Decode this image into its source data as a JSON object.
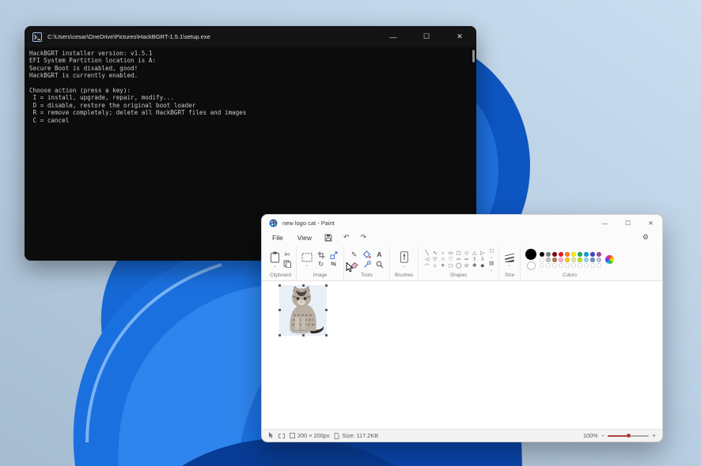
{
  "console": {
    "title": "C:\\Users\\cesar\\OneDrive\\Pictures\\HackBGRT-1.5.1\\setup.exe",
    "minimize": "—",
    "maximize": "☐",
    "close": "✕",
    "lines": [
      "HackBGRT installer version: v1.5.1",
      "EFI System Partition location is A:",
      "Secure Boot is disabled, good!",
      "HackBGRT is currently enabled.",
      "",
      "Choose action (press a key):",
      " I = install, upgrade, repair, modify...",
      " D = disable, restore the original boot loader",
      " R = remove completely; delete all HackBGRT files and images",
      " C = cancel"
    ]
  },
  "paint": {
    "title": "new logo cat - Paint",
    "minimize": "—",
    "maximize": "☐",
    "close": "✕",
    "menus": {
      "file": "File",
      "view": "View"
    },
    "undo": "↶",
    "redo": "↷",
    "settings": "⚙",
    "text_tool": "A",
    "sections": {
      "clipboard": "Clipboard",
      "image": "Image",
      "tools": "Tools",
      "brushes": "Brushes",
      "shapes": "Shapes",
      "size": "Size",
      "colors": "Colors"
    },
    "tool_chars": {
      "cut": "✄",
      "pencil": "✎",
      "rotate": "↻",
      "flip": "⇋"
    },
    "shapes_glyphs": [
      "╲",
      "∿",
      "○",
      "▭",
      "▢",
      "◇",
      "△",
      "▷",
      "◁",
      "▽",
      "☆",
      "♡",
      "⇦",
      "⇨",
      "⇧",
      "⇩",
      "◠",
      "⌂",
      "✶",
      "◻",
      "◯",
      "⊙",
      "✚",
      "◆"
    ],
    "colors": {
      "color1": "#000000",
      "color2": "#ffffff",
      "palette": [
        "#000000",
        "#7f7f7f",
        "#880015",
        "#ed1c24",
        "#ff7f27",
        "#fff200",
        "#22b14c",
        "#00a2e8",
        "#3f48cc",
        "#a349a4",
        "#ffffff",
        "#c3c3c3",
        "#b97a57",
        "#ffaec9",
        "#ffc90e",
        "#efe4b0",
        "#b5e61d",
        "#99d9ea",
        "#7092be",
        "#c8bfe7",
        "",
        "",
        "",
        "",
        "",
        "",
        "",
        "",
        "",
        ""
      ]
    },
    "status": {
      "dimensions": "200 × 200px",
      "file_size": "Size: 117.2KB",
      "zoom": "100%",
      "zoom_out": "−",
      "zoom_in": "+"
    }
  },
  "wallpaper": {
    "sky_top": "#c9def0",
    "sky_bottom": "#a8bed3",
    "petal_bright": "#2f85ee",
    "petal_mid": "#1b70e0",
    "petal_dark": "#0a47ae",
    "petal_deep": "#083c96",
    "petal_light": "#77b6f5"
  }
}
